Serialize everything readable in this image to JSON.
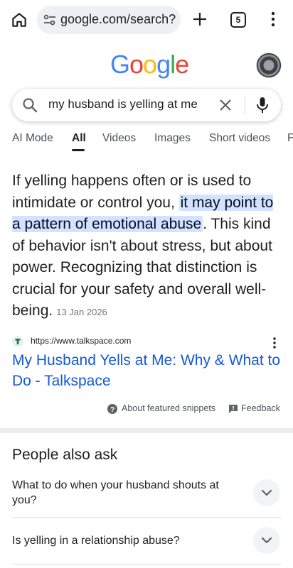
{
  "browser": {
    "url": "google.com/search?",
    "tab_count": "5"
  },
  "google": {
    "logo_letters": [
      {
        "ch": "G",
        "color": "#4285f4"
      },
      {
        "ch": "o",
        "color": "#ea4335"
      },
      {
        "ch": "o",
        "color": "#fbbc05"
      },
      {
        "ch": "g",
        "color": "#4285f4"
      },
      {
        "ch": "l",
        "color": "#34a853"
      },
      {
        "ch": "e",
        "color": "#ea4335"
      }
    ]
  },
  "search": {
    "query": "my husband is yelling at me"
  },
  "tabs": [
    "AI Mode",
    "All",
    "Videos",
    "Images",
    "Short videos",
    "F"
  ],
  "active_tab": "All",
  "snippet": {
    "text_before": "If yelling happens often or is used to intimidate or control you, ",
    "highlight": "it may point to a pattern of emotional abuse",
    "text_after": ". This kind of behavior isn't about stress, but about power. Recognizing that distinction is crucial for your safety and overall well-being.",
    "date": "13 Jan 2026",
    "source_url": "https://www.talkspace.com",
    "title": "My Husband Yells at Me: Why & What to Do - Talkspace"
  },
  "feedback_row": {
    "about_label": "About featured snippets",
    "feedback_label": "Feedback"
  },
  "paa": {
    "title": "People also ask",
    "questions": [
      "What to do when your husband shouts at you?",
      "Is yelling in a relationship abuse?"
    ]
  },
  "colors": {
    "link": "#1558d6",
    "highlight_bg": "#d3e3fd",
    "favicon": "#1e6b6b"
  }
}
